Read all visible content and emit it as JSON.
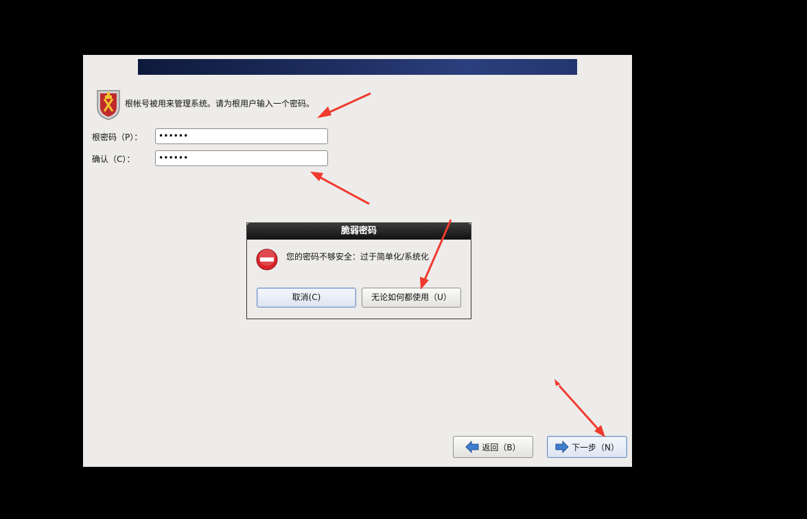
{
  "installer": {
    "intro_text": "根帐号被用来管理系统。请为根用户输入一个密码。",
    "root_password_label": "根密码（P）：",
    "root_password_value": "••••••",
    "confirm_label": "确认（C）：",
    "confirm_value": "••••••",
    "back_label": "返回（B）",
    "next_label": "下一步（N）"
  },
  "dialog": {
    "title": "脆弱密码",
    "message": "您的密码不够安全：过于简单化/系统化",
    "cancel_label": "取消(C)",
    "use_anyway_label": "无论如何都使用（U）"
  },
  "icons": {
    "shield": "root-shield-icon",
    "stop": "error-stop-icon",
    "back": "back-arrow-icon",
    "next": "next-arrow-icon"
  },
  "colors": {
    "background": "#000000",
    "window": "#edecea",
    "banner": "#1e2e60",
    "annotation_arrow": "#f03a2e",
    "stop_icon": "#d8232a"
  }
}
